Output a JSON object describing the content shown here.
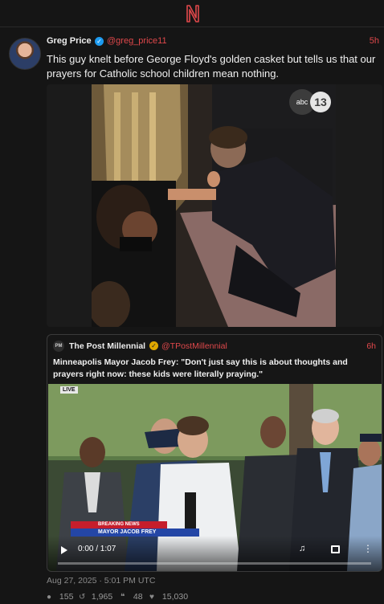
{
  "app": {
    "logo_letter": "N",
    "accent": "#e0484b"
  },
  "post": {
    "author_name": "Greg Price",
    "handle": "@greg_price11",
    "time": "5h",
    "text": "This guy knelt before George Floyd's golden casket but tells us that our prayers for Catholic school children mean nothing.",
    "media": {
      "channel_logo": "abc 13"
    },
    "timestamp": "Aug 27, 2025 · 5:01 PM UTC",
    "stats": {
      "replies": "155",
      "reposts": "1,965",
      "quotes": "48",
      "likes": "15,030"
    }
  },
  "quote": {
    "avatar_text": "PM",
    "author_name": "The Post Millennial",
    "handle": "@TPostMillennial",
    "time": "6h",
    "text": "Minneapolis Mayor Jacob Frey: \"Don't just say this is about thoughts and prayers right now: these kids were literally praying.\"",
    "video": {
      "live_badge": "LIVE",
      "time_display": "0:00 / 1:07",
      "progress": 0,
      "lower_third_tag": "BREAKING NEWS",
      "lower_third_name": "MAYOR JACOB FREY"
    }
  },
  "icons": {
    "reply": "comment-icon",
    "repost": "repost-icon",
    "quote": "quote-icon",
    "like": "heart-icon"
  }
}
